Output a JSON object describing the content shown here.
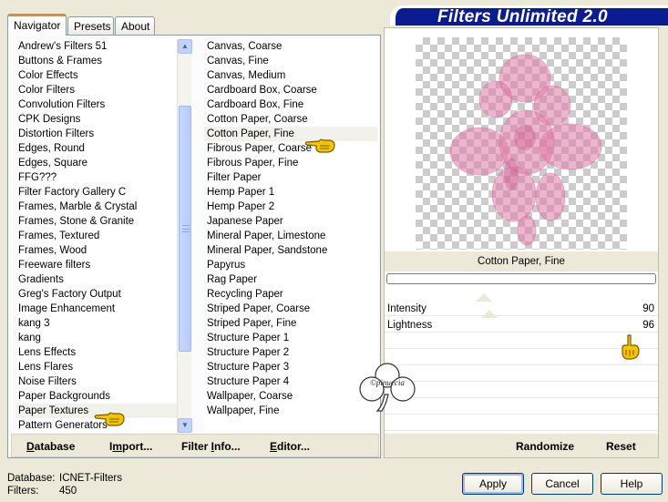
{
  "app_title": "Filters Unlimited 2.0",
  "tabs": [
    {
      "label": "Navigator"
    },
    {
      "label": "Presets"
    },
    {
      "label": "About"
    }
  ],
  "categories": [
    "Andrew's Filters 51",
    "Buttons & Frames",
    "Color Effects",
    "Color Filters",
    "Convolution Filters",
    "CPK Designs",
    "Distortion Filters",
    "Edges, Round",
    "Edges, Square",
    "FFG???",
    "Filter Factory Gallery C",
    "Frames, Marble & Crystal",
    "Frames, Stone & Granite",
    "Frames, Textured",
    "Frames, Wood",
    "Freeware filters",
    "Gradients",
    "Greg's Factory Output",
    "Image Enhancement",
    "kang 3",
    "kang",
    "Lens Effects",
    "Lens Flares",
    "Noise Filters",
    "Paper Backgrounds",
    "Paper Textures",
    "Pattern Generators"
  ],
  "selected_category": "Paper Textures",
  "filters": [
    "Canvas, Coarse",
    "Canvas, Fine",
    "Canvas, Medium",
    "Cardboard Box, Coarse",
    "Cardboard Box, Fine",
    "Cotton Paper, Coarse",
    "Cotton Paper, Fine",
    "Fibrous Paper, Coarse",
    "Fibrous Paper, Fine",
    "Filter Paper",
    "Hemp Paper 1",
    "Hemp Paper 2",
    "Japanese Paper",
    "Mineral Paper, Limestone",
    "Mineral Paper, Sandstone",
    "Papyrus",
    "Rag Paper",
    "Recycling Paper",
    "Striped Paper, Coarse",
    "Striped Paper, Fine",
    "Structure Paper 1",
    "Structure Paper 2",
    "Structure Paper 3",
    "Structure Paper 4",
    "Wallpaper, Coarse",
    "Wallpaper, Fine"
  ],
  "selected_filter": "Cotton Paper, Fine",
  "left_buttons": {
    "database": {
      "u": "D",
      "rest": "atabase"
    },
    "import": {
      "pre": "I",
      "u": "m",
      "rest": "port..."
    },
    "filter_info": {
      "pre": "Filter ",
      "u": "I",
      "rest": "nfo..."
    },
    "editor": {
      "u": "E",
      "rest": "ditor..."
    }
  },
  "sliders": [
    {
      "label": "Intensity",
      "value": 90
    },
    {
      "label": "Lightness",
      "value": 96
    }
  ],
  "right_buttons": {
    "randomize": "Randomize",
    "reset": "Reset"
  },
  "status": {
    "database_label": "Database:",
    "database_value": "ICNET-Filters",
    "filters_label": "Filters:",
    "filters_value": "450"
  },
  "dialog_buttons": {
    "apply": "Apply",
    "cancel": "Cancel",
    "help": "Help"
  },
  "watermark": "©pinuccia",
  "colors": {
    "title_bg": "#0a1c8f",
    "tab_accent": "#e68b2c",
    "panel_bg": "#ece9d8",
    "flower": "#e07aa6",
    "hand": "#f5c400"
  },
  "icons": [
    "pointing-hand-icon",
    "scroll-up-arrow-icon",
    "scroll-down-arrow-icon",
    "scroll-grip-icon"
  ]
}
